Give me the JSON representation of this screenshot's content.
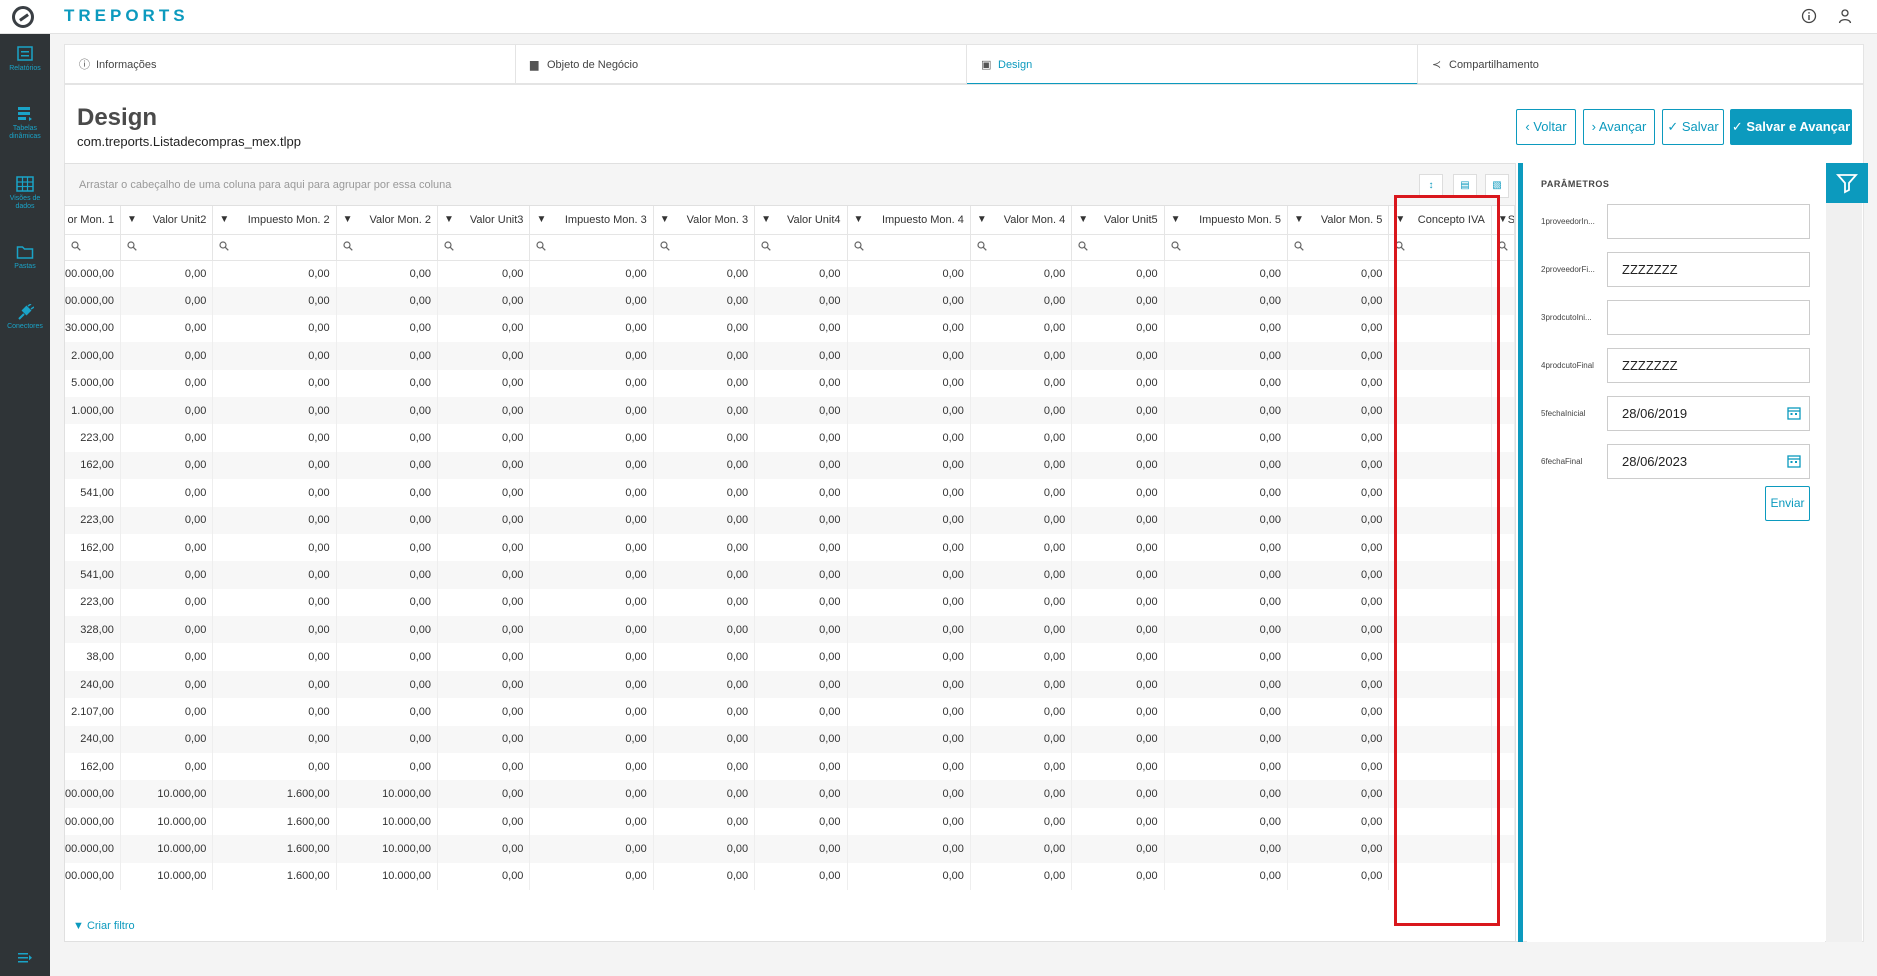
{
  "app": {
    "brand": "TREPORTS"
  },
  "sidebar": {
    "items": [
      {
        "label": "Relatórios"
      },
      {
        "label": "Tabelas dinâmicas"
      },
      {
        "label": "Visões de dados"
      },
      {
        "label": "Pastas"
      },
      {
        "label": "Conectores"
      }
    ]
  },
  "tabs": [
    {
      "label": "Informações"
    },
    {
      "label": "Objeto de Negócio"
    },
    {
      "label": "Design"
    },
    {
      "label": "Compartilhamento"
    }
  ],
  "page": {
    "title": "Design",
    "subtitle": "com.treports.Listadecompras_mex.tlpp"
  },
  "actions": {
    "voltar": "Voltar",
    "avancar": "Avançar",
    "salvar": "Salvar",
    "salvar_avancar": "Salvar e Avançar"
  },
  "grid": {
    "group_hint": "Arrastar o cabeçalho de uma coluna para aqui para agrupar por essa coluna",
    "columns": [
      "or Mon. 1",
      "Valor Unit2",
      "Impuesto Mon. 2",
      "Valor Mon. 2",
      "Valor Unit3",
      "Impuesto Mon. 3",
      "Valor Mon. 3",
      "Valor Unit4",
      "Impuesto Mon. 4",
      "Valor Mon. 4",
      "Valor Unit5",
      "Impuesto Mon. 5",
      "Valor Mon. 5",
      "Concepto IVA",
      "Su"
    ],
    "rows": [
      [
        "00.000,00",
        "0,00",
        "0,00",
        "0,00",
        "0,00",
        "0,00",
        "0,00",
        "0,00",
        "0,00",
        "0,00",
        "0,00",
        "0,00",
        "0,00",
        "",
        ""
      ],
      [
        "00.000,00",
        "0,00",
        "0,00",
        "0,00",
        "0,00",
        "0,00",
        "0,00",
        "0,00",
        "0,00",
        "0,00",
        "0,00",
        "0,00",
        "0,00",
        "",
        ""
      ],
      [
        "30.000,00",
        "0,00",
        "0,00",
        "0,00",
        "0,00",
        "0,00",
        "0,00",
        "0,00",
        "0,00",
        "0,00",
        "0,00",
        "0,00",
        "0,00",
        "",
        ""
      ],
      [
        "2.000,00",
        "0,00",
        "0,00",
        "0,00",
        "0,00",
        "0,00",
        "0,00",
        "0,00",
        "0,00",
        "0,00",
        "0,00",
        "0,00",
        "0,00",
        "",
        ""
      ],
      [
        "5.000,00",
        "0,00",
        "0,00",
        "0,00",
        "0,00",
        "0,00",
        "0,00",
        "0,00",
        "0,00",
        "0,00",
        "0,00",
        "0,00",
        "0,00",
        "",
        ""
      ],
      [
        "1.000,00",
        "0,00",
        "0,00",
        "0,00",
        "0,00",
        "0,00",
        "0,00",
        "0,00",
        "0,00",
        "0,00",
        "0,00",
        "0,00",
        "0,00",
        "",
        ""
      ],
      [
        "223,00",
        "0,00",
        "0,00",
        "0,00",
        "0,00",
        "0,00",
        "0,00",
        "0,00",
        "0,00",
        "0,00",
        "0,00",
        "0,00",
        "0,00",
        "",
        ""
      ],
      [
        "162,00",
        "0,00",
        "0,00",
        "0,00",
        "0,00",
        "0,00",
        "0,00",
        "0,00",
        "0,00",
        "0,00",
        "0,00",
        "0,00",
        "0,00",
        "",
        ""
      ],
      [
        "541,00",
        "0,00",
        "0,00",
        "0,00",
        "0,00",
        "0,00",
        "0,00",
        "0,00",
        "0,00",
        "0,00",
        "0,00",
        "0,00",
        "0,00",
        "",
        ""
      ],
      [
        "223,00",
        "0,00",
        "0,00",
        "0,00",
        "0,00",
        "0,00",
        "0,00",
        "0,00",
        "0,00",
        "0,00",
        "0,00",
        "0,00",
        "0,00",
        "",
        ""
      ],
      [
        "162,00",
        "0,00",
        "0,00",
        "0,00",
        "0,00",
        "0,00",
        "0,00",
        "0,00",
        "0,00",
        "0,00",
        "0,00",
        "0,00",
        "0,00",
        "",
        ""
      ],
      [
        "541,00",
        "0,00",
        "0,00",
        "0,00",
        "0,00",
        "0,00",
        "0,00",
        "0,00",
        "0,00",
        "0,00",
        "0,00",
        "0,00",
        "0,00",
        "",
        ""
      ],
      [
        "223,00",
        "0,00",
        "0,00",
        "0,00",
        "0,00",
        "0,00",
        "0,00",
        "0,00",
        "0,00",
        "0,00",
        "0,00",
        "0,00",
        "0,00",
        "",
        ""
      ],
      [
        "328,00",
        "0,00",
        "0,00",
        "0,00",
        "0,00",
        "0,00",
        "0,00",
        "0,00",
        "0,00",
        "0,00",
        "0,00",
        "0,00",
        "0,00",
        "",
        ""
      ],
      [
        "38,00",
        "0,00",
        "0,00",
        "0,00",
        "0,00",
        "0,00",
        "0,00",
        "0,00",
        "0,00",
        "0,00",
        "0,00",
        "0,00",
        "0,00",
        "",
        ""
      ],
      [
        "240,00",
        "0,00",
        "0,00",
        "0,00",
        "0,00",
        "0,00",
        "0,00",
        "0,00",
        "0,00",
        "0,00",
        "0,00",
        "0,00",
        "0,00",
        "",
        ""
      ],
      [
        "2.107,00",
        "0,00",
        "0,00",
        "0,00",
        "0,00",
        "0,00",
        "0,00",
        "0,00",
        "0,00",
        "0,00",
        "0,00",
        "0,00",
        "0,00",
        "",
        ""
      ],
      [
        "240,00",
        "0,00",
        "0,00",
        "0,00",
        "0,00",
        "0,00",
        "0,00",
        "0,00",
        "0,00",
        "0,00",
        "0,00",
        "0,00",
        "0,00",
        "",
        ""
      ],
      [
        "162,00",
        "0,00",
        "0,00",
        "0,00",
        "0,00",
        "0,00",
        "0,00",
        "0,00",
        "0,00",
        "0,00",
        "0,00",
        "0,00",
        "0,00",
        "",
        ""
      ],
      [
        "00.000,00",
        "10.000,00",
        "1.600,00",
        "10.000,00",
        "0,00",
        "0,00",
        "0,00",
        "0,00",
        "0,00",
        "0,00",
        "0,00",
        "0,00",
        "0,00",
        "",
        ""
      ],
      [
        "00.000,00",
        "10.000,00",
        "1.600,00",
        "10.000,00",
        "0,00",
        "0,00",
        "0,00",
        "0,00",
        "0,00",
        "0,00",
        "0,00",
        "0,00",
        "0,00",
        "",
        ""
      ],
      [
        "00.000,00",
        "10.000,00",
        "1.600,00",
        "10.000,00",
        "0,00",
        "0,00",
        "0,00",
        "0,00",
        "0,00",
        "0,00",
        "0,00",
        "0,00",
        "0,00",
        "",
        ""
      ],
      [
        "00.000,00",
        "10.000,00",
        "1.600,00",
        "10.000,00",
        "0,00",
        "0,00",
        "0,00",
        "0,00",
        "0,00",
        "0,00",
        "0,00",
        "0,00",
        "0,00",
        "",
        ""
      ]
    ],
    "criar_filtro": "Criar filtro"
  },
  "params": {
    "title": "PARÂMETROS",
    "fields": [
      {
        "label": "1proveedorIn...",
        "value": ""
      },
      {
        "label": "2proveedorFi...",
        "value": "ZZZZZZZ"
      },
      {
        "label": "3prodcutoIni...",
        "value": ""
      },
      {
        "label": "4prodcutoFinal",
        "value": "ZZZZZZZ"
      },
      {
        "label": "5fechaInicial",
        "value": "28/06/2019"
      },
      {
        "label": "6fechaFinal",
        "value": "28/06/2023"
      }
    ],
    "submit": "Enviar"
  },
  "colors": {
    "accent": "#0c9abe",
    "sidebar": "#2f3437",
    "highlight": "#d9171d"
  }
}
